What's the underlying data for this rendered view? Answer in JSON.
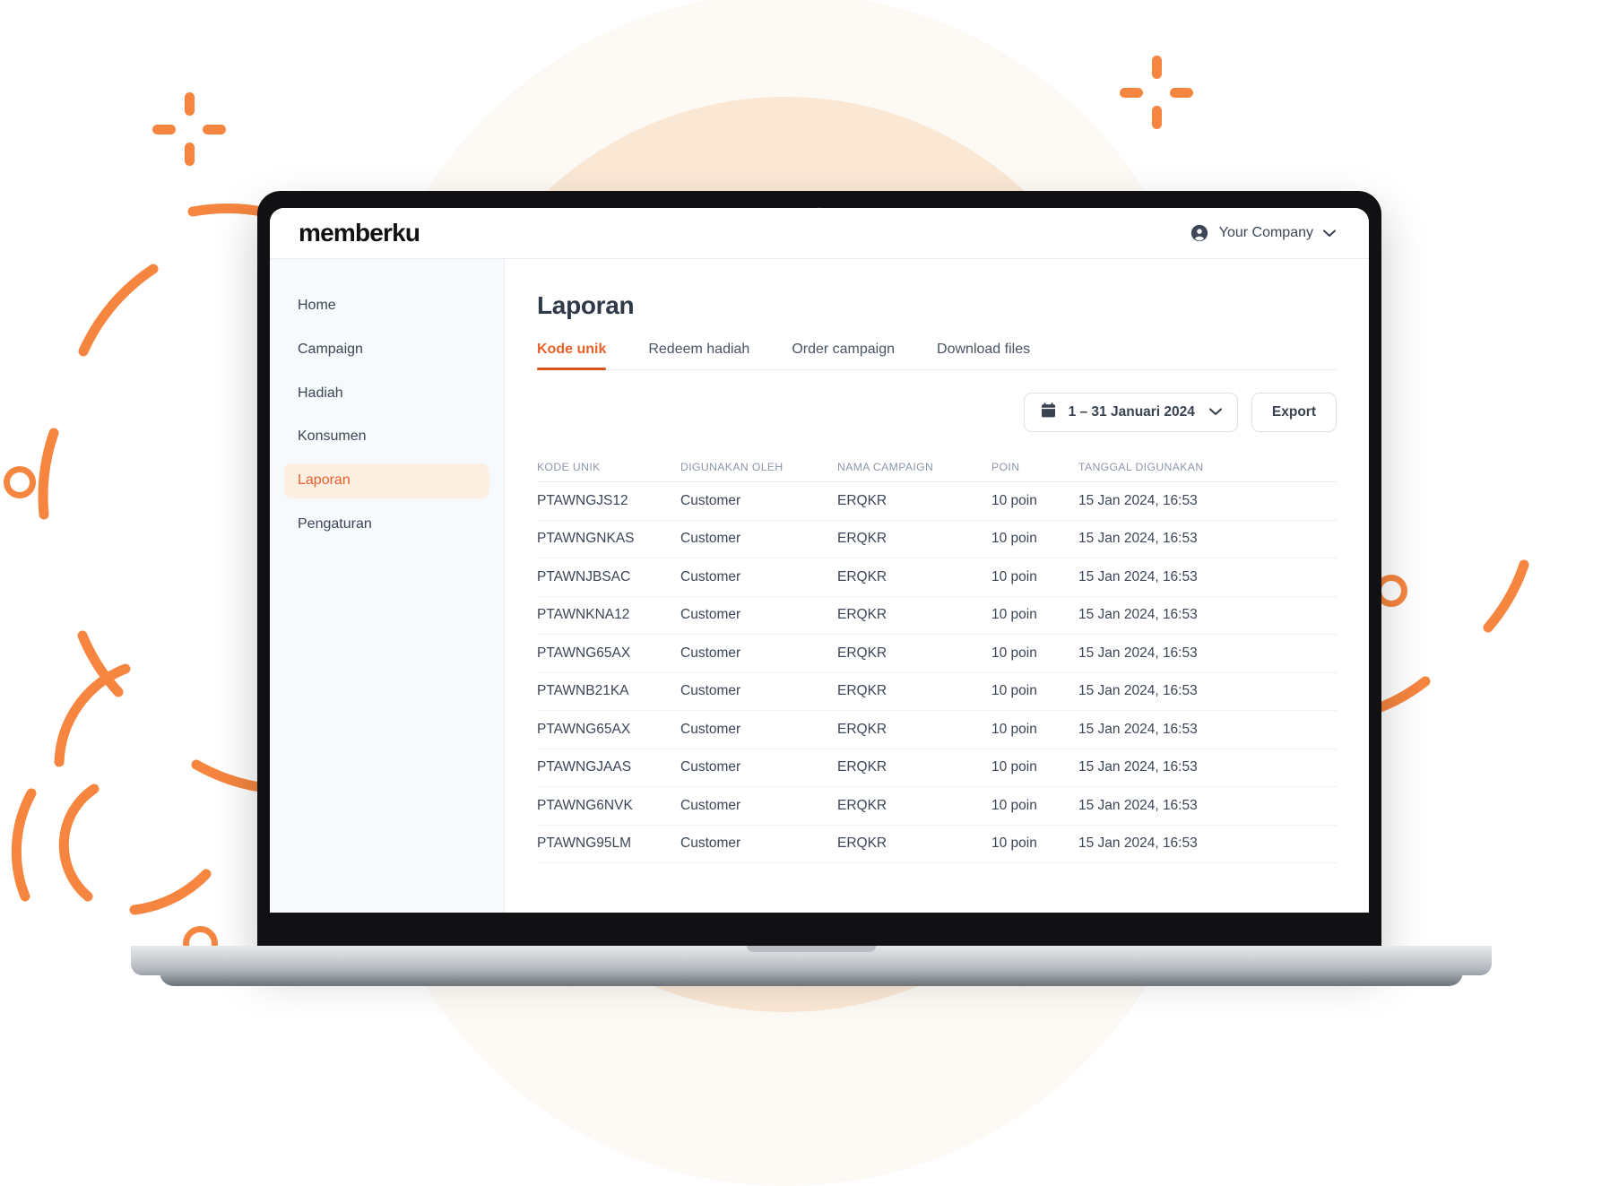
{
  "brand": {
    "logo": "memberku",
    "accent": "#E8612B",
    "accent_soft": "#FDEEE2",
    "decor_orange": "#F5853F",
    "bg_cream": "#FDFAF5",
    "bg_peach": "#FAE7D4"
  },
  "topbar": {
    "account_name": "Your Company",
    "avatar_icon": "user-circle-icon",
    "chevron_icon": "chevron-down-icon"
  },
  "sidebar": {
    "items": [
      {
        "label": "Home",
        "active": false
      },
      {
        "label": "Campaign",
        "active": false
      },
      {
        "label": "Hadiah",
        "active": false
      },
      {
        "label": "Konsumen",
        "active": false
      },
      {
        "label": "Laporan",
        "active": true
      },
      {
        "label": "Pengaturan",
        "active": false
      }
    ]
  },
  "main": {
    "page_title": "Laporan",
    "tabs": [
      {
        "label": "Kode unik",
        "active": true
      },
      {
        "label": "Redeem hadiah",
        "active": false
      },
      {
        "label": "Order campaign",
        "active": false
      },
      {
        "label": "Download files",
        "active": false
      }
    ],
    "toolbar": {
      "date_range": "1 – 31 Januari 2024",
      "calendar_icon": "calendar-icon",
      "dropdown_icon": "chevron-down-icon",
      "export_label": "Export"
    },
    "table": {
      "columns": [
        "KODE UNIK",
        "DIGUNAKAN OLEH",
        "NAMA CAMPAIGN",
        "POIN",
        "TANGGAL DIGUNAKAN"
      ],
      "rows": [
        {
          "kode": "PTAWNGJS12",
          "oleh": "Customer",
          "campaign": "ERQKR",
          "poin": "10 poin",
          "tanggal": "15 Jan 2024, 16:53"
        },
        {
          "kode": "PTAWNGNKAS",
          "oleh": "Customer",
          "campaign": "ERQKR",
          "poin": "10 poin",
          "tanggal": "15 Jan 2024, 16:53"
        },
        {
          "kode": "PTAWNJBSAC",
          "oleh": "Customer",
          "campaign": "ERQKR",
          "poin": "10 poin",
          "tanggal": "15 Jan 2024, 16:53"
        },
        {
          "kode": "PTAWNKNA12",
          "oleh": "Customer",
          "campaign": "ERQKR",
          "poin": "10 poin",
          "tanggal": "15 Jan 2024, 16:53"
        },
        {
          "kode": "PTAWNG65AX",
          "oleh": "Customer",
          "campaign": "ERQKR",
          "poin": "10 poin",
          "tanggal": "15 Jan 2024, 16:53"
        },
        {
          "kode": "PTAWNB21KA",
          "oleh": "Customer",
          "campaign": "ERQKR",
          "poin": "10 poin",
          "tanggal": "15 Jan 2024, 16:53"
        },
        {
          "kode": "PTAWNG65AX",
          "oleh": "Customer",
          "campaign": "ERQKR",
          "poin": "10 poin",
          "tanggal": "15 Jan 2024, 16:53"
        },
        {
          "kode": "PTAWNGJAAS",
          "oleh": "Customer",
          "campaign": "ERQKR",
          "poin": "10 poin",
          "tanggal": "15 Jan 2024, 16:53"
        },
        {
          "kode": "PTAWNG6NVK",
          "oleh": "Customer",
          "campaign": "ERQKR",
          "poin": "10 poin",
          "tanggal": "15 Jan 2024, 16:53"
        },
        {
          "kode": "PTAWNG95LM",
          "oleh": "Customer",
          "campaign": "ERQKR",
          "poin": "10 poin",
          "tanggal": "15 Jan 2024, 16:53"
        }
      ]
    }
  },
  "decorations": {
    "sparkles": [
      "sparkle-icon",
      "sparkle-icon",
      "sparkle-icon"
    ],
    "rings": [
      "ring-icon",
      "ring-icon",
      "ring-icon"
    ],
    "arcs": "dashed-circle-arcs"
  }
}
